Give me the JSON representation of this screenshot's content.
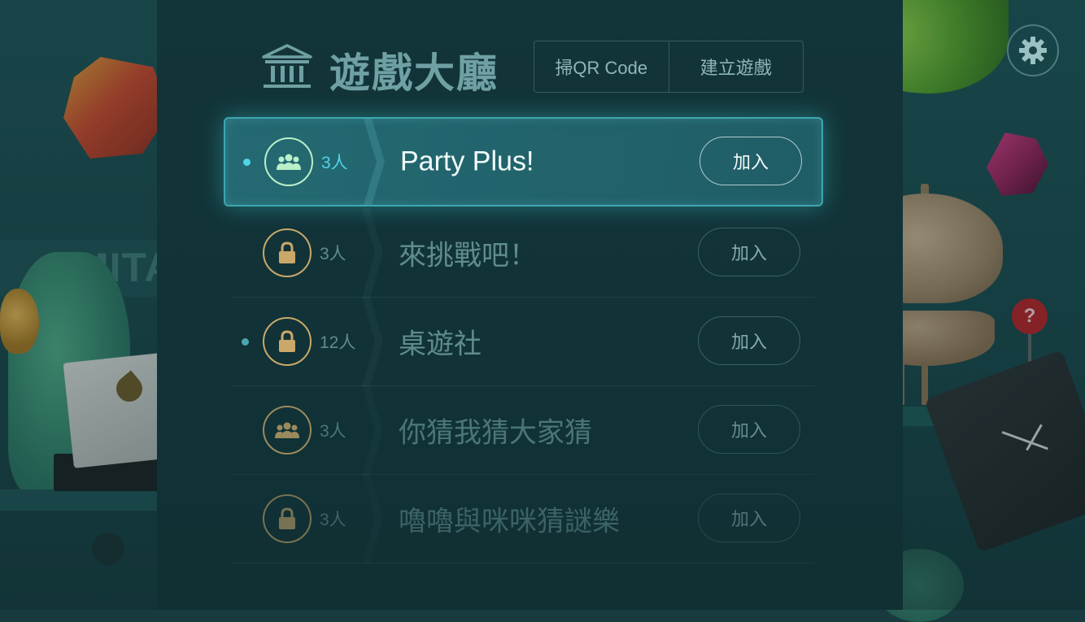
{
  "header": {
    "title": "遊戲大廳",
    "icon": "bank-icon",
    "buttons": {
      "scan_qr": "掃QR Code",
      "create_game": "建立遊戲"
    },
    "settings_icon": "gear-icon"
  },
  "background": {
    "banner_text": "MITAKE",
    "sign_text": "?"
  },
  "rooms": [
    {
      "name": "Party Plus!",
      "count": "3人",
      "icon": "group-icon",
      "locked": false,
      "dot": true,
      "join_label": "加入",
      "selected": true
    },
    {
      "name": "來挑戰吧！",
      "count": "3人",
      "icon": "lock-icon",
      "locked": true,
      "dot": false,
      "join_label": "加入",
      "selected": false
    },
    {
      "name": "桌遊社",
      "count": "12人",
      "icon": "lock-icon",
      "locked": true,
      "dot": true,
      "join_label": "加入",
      "selected": false
    },
    {
      "name": "你猜我猜大家猜",
      "count": "3人",
      "icon": "group-icon",
      "locked": false,
      "dot": false,
      "join_label": "加入",
      "selected": false
    },
    {
      "name": "嚕嚕與咪咪猜謎樂",
      "count": "3人",
      "icon": "lock-icon",
      "locked": true,
      "dot": false,
      "join_label": "加入",
      "selected": false
    }
  ],
  "colors": {
    "accent": "#4fd4e6",
    "accent_green": "#b9f0c8",
    "gold": "#caa86a",
    "text_dim": "#5f8c8f"
  }
}
